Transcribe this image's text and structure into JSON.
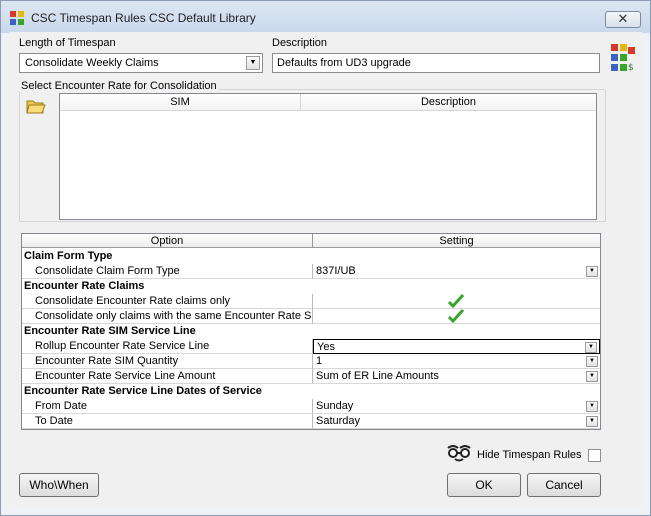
{
  "window": {
    "title": "CSC Timespan Rules  CSC Default Library",
    "close_glyph": "✕"
  },
  "form": {
    "length_label": "Length of Timespan",
    "length_value": "Consolidate Weekly Claims",
    "description_label": "Description",
    "description_value": "Defaults from UD3 upgrade"
  },
  "encounter_group": {
    "title": "Select Encounter Rate for Consolidation",
    "columns": [
      "SIM",
      "Description"
    ]
  },
  "grid": {
    "columns": [
      "Option",
      "Setting"
    ],
    "sections": [
      {
        "title": "Claim Form Type",
        "rows": [
          {
            "option": "Consolidate Claim Form Type",
            "setting": "837I/UB",
            "kind": "dropdown"
          }
        ]
      },
      {
        "title": "Encounter Rate Claims",
        "rows": [
          {
            "option": "Consolidate Encounter Rate claims  only",
            "setting": "",
            "kind": "check",
            "checked": true
          },
          {
            "option": "Consolidate only claims with the same Encounter Rate SIM",
            "setting": "",
            "kind": "check",
            "checked": true
          }
        ]
      },
      {
        "title": "Encounter Rate SIM Service Line",
        "rows": [
          {
            "option": "Rollup Encounter Rate Service Line",
            "setting": "Yes",
            "kind": "dropdown",
            "focused": true
          },
          {
            "option": "Encounter Rate SIM Quantity",
            "setting": "1",
            "kind": "dropdown"
          },
          {
            "option": "Encounter Rate Service Line Amount",
            "setting": "Sum of ER Line Amounts",
            "kind": "dropdown"
          }
        ]
      },
      {
        "title": "Encounter Rate Service Line Dates of Service",
        "rows": [
          {
            "option": "From Date",
            "setting": "Sunday",
            "kind": "dropdown"
          },
          {
            "option": "To Date",
            "setting": "Saturday",
            "kind": "dropdown"
          }
        ]
      }
    ]
  },
  "footer": {
    "hide_label": "Hide Timespan Rules",
    "hide_checked": false,
    "who_when_label": "Who\\When",
    "ok_label": "OK",
    "cancel_label": "Cancel"
  },
  "colors": {
    "check_green": "#3aa52c",
    "titlebar": "#c9d8ec"
  }
}
